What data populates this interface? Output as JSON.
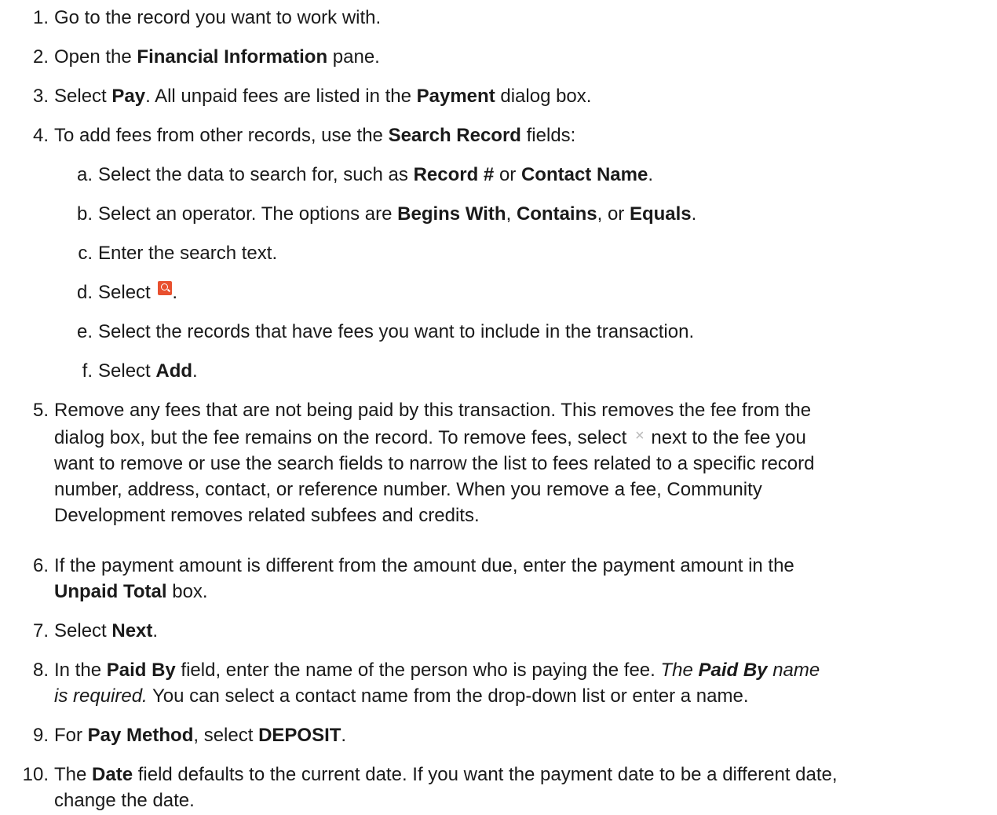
{
  "steps": [
    {
      "num": "1.",
      "parts": [
        {
          "t": "Go to the record you want to work with."
        }
      ]
    },
    {
      "num": "2.",
      "parts": [
        {
          "t": "Open the "
        },
        {
          "b": "Financial Information"
        },
        {
          "t": " pane."
        }
      ]
    },
    {
      "num": "3.",
      "parts": [
        {
          "t": "Select "
        },
        {
          "b": "Pay"
        },
        {
          "t": ". All unpaid fees are listed in the "
        },
        {
          "b": "Payment"
        },
        {
          "t": " dialog box."
        }
      ]
    },
    {
      "num": "4.",
      "parts": [
        {
          "t": "To add fees from other records, use the "
        },
        {
          "b": "Search Record"
        },
        {
          "t": " fields:"
        }
      ]
    },
    {
      "num": "a.",
      "sub": true,
      "parts": [
        {
          "t": "Select the data to search for, such as "
        },
        {
          "b": "Record #"
        },
        {
          "t": " or "
        },
        {
          "b": "Contact Name"
        },
        {
          "t": "."
        }
      ]
    },
    {
      "num": "b.",
      "sub": true,
      "parts": [
        {
          "t": "Select an operator. The options are "
        },
        {
          "b": "Begins With"
        },
        {
          "t": ", "
        },
        {
          "b": "Contains"
        },
        {
          "t": ", or "
        },
        {
          "b": "Equals"
        },
        {
          "t": "."
        }
      ]
    },
    {
      "num": "c.",
      "sub": true,
      "parts": [
        {
          "t": "Enter the search text."
        }
      ]
    },
    {
      "num": "d.",
      "sub": true,
      "parts": [
        {
          "t": "Select "
        },
        {
          "icon": "search-icon"
        },
        {
          "t": "."
        }
      ]
    },
    {
      "num": "e.",
      "sub": true,
      "parts": [
        {
          "t": "Select the records that have fees you want to include in the transaction."
        }
      ]
    },
    {
      "num": "f.",
      "sub": true,
      "parts": [
        {
          "t": "Select "
        },
        {
          "b": "Add"
        },
        {
          "t": "."
        }
      ]
    },
    {
      "num": "5.",
      "parts": [
        {
          "t": "Remove any fees that are not being paid by this transaction. This removes the fee from the"
        },
        {
          "br": true
        },
        {
          "t": "dialog box, but the fee remains on the record. To remove fees, select "
        },
        {
          "icon": "close-icon",
          "glyph": "×"
        },
        {
          "t": " next to the fee you"
        },
        {
          "br": true
        },
        {
          "t": "want to remove or use the search fields to narrow the list to fees related to a specific record"
        },
        {
          "br": true
        },
        {
          "t": "number, address, contact, or reference number. When you remove a fee, Community"
        },
        {
          "br": true
        },
        {
          "t": "Development removes related subfees and credits."
        }
      ]
    },
    {
      "num": "6.",
      "parts": [
        {
          "t": "If the payment amount is different from the amount due, enter the payment amount in the"
        },
        {
          "br": true
        },
        {
          "b": "Unpaid Total"
        },
        {
          "t": " box."
        }
      ]
    },
    {
      "num": "7.",
      "parts": [
        {
          "t": "Select "
        },
        {
          "b": "Next"
        },
        {
          "t": "."
        }
      ]
    },
    {
      "num": "8.",
      "parts": [
        {
          "t": "In the "
        },
        {
          "b": "Paid By"
        },
        {
          "t": " field, enter the name of the person who is paying the fee. "
        },
        {
          "i": "The "
        },
        {
          "bi": "Paid By"
        },
        {
          "i": " name"
        },
        {
          "br": true
        },
        {
          "i": "is required."
        },
        {
          "t": " You can select a contact name from the drop-down list or enter a name."
        }
      ]
    },
    {
      "num": "9.",
      "parts": [
        {
          "t": "For "
        },
        {
          "b": "Pay Method"
        },
        {
          "t": ", select "
        },
        {
          "b": "DEPOSIT"
        },
        {
          "t": "."
        }
      ]
    },
    {
      "num": "10.",
      "parts": [
        {
          "t": "The "
        },
        {
          "b": "Date"
        },
        {
          "t": " field defaults to the current date. If you want the payment date to be a different date,"
        },
        {
          "br": true
        },
        {
          "t": "change the date."
        }
      ]
    }
  ]
}
